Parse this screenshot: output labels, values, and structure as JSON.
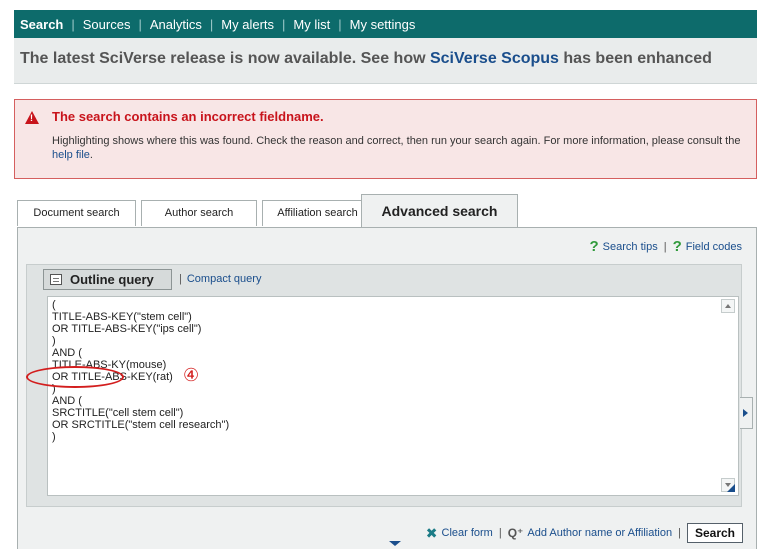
{
  "nav": {
    "items": [
      "Search",
      "Sources",
      "Analytics",
      "My alerts",
      "My list",
      "My settings"
    ],
    "separator": "|"
  },
  "banner": {
    "prefix": "The latest SciVerse release is now available. See how ",
    "link": "SciVerse Scopus",
    "suffix": " has been enhanced"
  },
  "error": {
    "title": "The search contains an incorrect fieldname.",
    "body": "Highlighting shows where this was found. Check the reason and correct, then run your search again. For more information, please consult the ",
    "link": "help file",
    "end": "."
  },
  "tabs": [
    "Document search",
    "Author search",
    "Affiliation search",
    "Advanced search"
  ],
  "tips": {
    "search_tips": "Search tips",
    "field_codes": "Field codes",
    "icon": "question-icon",
    "separator": "|"
  },
  "query": {
    "outline_label": "Outline query",
    "compact_label": "Compact query",
    "separator": "|",
    "lines": [
      "(",
      "TITLE-ABS-KEY(\"stem cell\")",
      "OR TITLE-ABS-KEY(\"ips cell\")",
      ")",
      "AND (",
      "TITLE-ABS-KY(mouse)",
      "OR TITLE-ABS-KEY(rat)",
      ")",
      "AND (",
      "SRCTITLE(\"cell stem cell\")",
      "OR SRCTITLE(\"stem cell research\")",
      ")"
    ]
  },
  "annotation": {
    "marker": "④",
    "color": "#d31e1e"
  },
  "footer": {
    "clear_form": "Clear form",
    "add_author": "Add Author name or Affiliation",
    "search_button": "Search",
    "separator": "|"
  },
  "colors": {
    "nav_bg": "#0d6b6b",
    "link": "#1a4e8c",
    "error_text": "#c8141c",
    "error_bg": "#f8e6e6"
  }
}
